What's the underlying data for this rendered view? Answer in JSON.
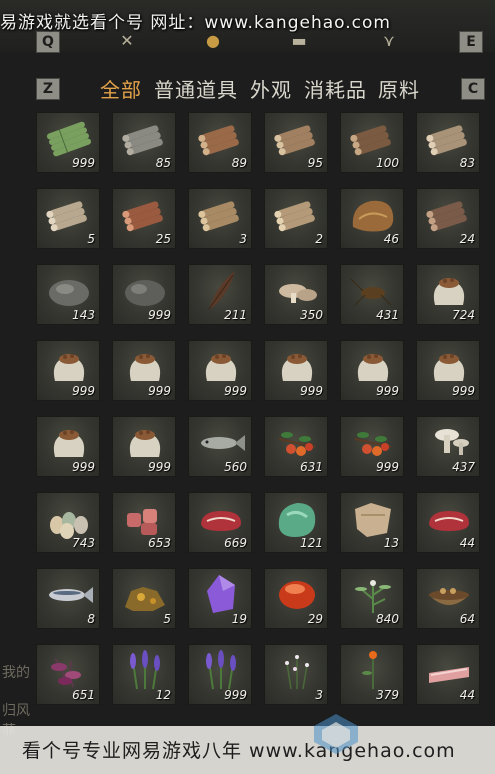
{
  "watermark_top": "易游戏就选看个号   网址：www.kangehao.com",
  "watermark_bottom": "看个号专业网易游戏八年  www.kangehao.com",
  "hotkeys": {
    "q": "Q",
    "e": "E",
    "z": "Z",
    "c": "C"
  },
  "tabs": [
    "全部",
    "普通道具",
    "外观",
    "消耗品",
    "原料"
  ],
  "left_deco": [
    "我的",
    "归风菲"
  ],
  "items": [
    {
      "icon": "bamboo-icon",
      "count": "999"
    },
    {
      "icon": "logs-grey-icon",
      "count": "85"
    },
    {
      "icon": "logs-brown-icon",
      "count": "89"
    },
    {
      "icon": "logs-icon",
      "count": "95"
    },
    {
      "icon": "firewood-icon",
      "count": "100"
    },
    {
      "icon": "logs-light-icon",
      "count": "83"
    },
    {
      "icon": "logs-pale-icon",
      "count": "5"
    },
    {
      "icon": "logs-red-icon",
      "count": "25"
    },
    {
      "icon": "logs-tan-icon",
      "count": "3"
    },
    {
      "icon": "logs-beige-icon",
      "count": "2"
    },
    {
      "icon": "fur-pelt-icon",
      "count": "46"
    },
    {
      "icon": "logs-dark-icon",
      "count": "24"
    },
    {
      "icon": "stone-icon",
      "count": "143"
    },
    {
      "icon": "stone-dark-icon",
      "count": "999"
    },
    {
      "icon": "feather-icon",
      "count": "211"
    },
    {
      "icon": "mushroom-icon",
      "count": "350"
    },
    {
      "icon": "cricket-icon",
      "count": "431"
    },
    {
      "icon": "seed-sack-icon",
      "count": "724"
    },
    {
      "icon": "seed-sack-icon",
      "count": "999"
    },
    {
      "icon": "seed-sack-icon",
      "count": "999"
    },
    {
      "icon": "seed-sack-icon",
      "count": "999"
    },
    {
      "icon": "seed-sack-icon",
      "count": "999"
    },
    {
      "icon": "seed-sack-icon",
      "count": "999"
    },
    {
      "icon": "seed-sack-icon",
      "count": "999"
    },
    {
      "icon": "seed-sack-icon",
      "count": "999"
    },
    {
      "icon": "seed-sack-icon",
      "count": "999"
    },
    {
      "icon": "fish-icon",
      "count": "560"
    },
    {
      "icon": "berry-branch-icon",
      "count": "631"
    },
    {
      "icon": "berry-branch-icon",
      "count": "999"
    },
    {
      "icon": "mushrooms-white-icon",
      "count": "437"
    },
    {
      "icon": "eggs-icon",
      "count": "743"
    },
    {
      "icon": "raw-meat-chunks-icon",
      "count": "653"
    },
    {
      "icon": "steak-icon",
      "count": "669"
    },
    {
      "icon": "jade-stone-icon",
      "count": "121"
    },
    {
      "icon": "hide-icon",
      "count": "13"
    },
    {
      "icon": "steak-icon",
      "count": "44"
    },
    {
      "icon": "salmon-icon",
      "count": "8"
    },
    {
      "icon": "ore-icon",
      "count": "5"
    },
    {
      "icon": "amethyst-icon",
      "count": "19"
    },
    {
      "icon": "red-gem-icon",
      "count": "29"
    },
    {
      "icon": "herb-icon",
      "count": "840"
    },
    {
      "icon": "herb-bowl-icon",
      "count": "64"
    },
    {
      "icon": "purple-flower-icon",
      "count": "651"
    },
    {
      "icon": "lavender-icon",
      "count": "12"
    },
    {
      "icon": "lavender-icon",
      "count": "999"
    },
    {
      "icon": "white-flower-icon",
      "count": "3"
    },
    {
      "icon": "orange-flower-icon",
      "count": "379"
    },
    {
      "icon": "meat-slices-icon",
      "count": "44"
    }
  ],
  "colors": {
    "active_tab": "#e3a34a",
    "tab": "#d9d6cc",
    "slot": "#353630"
  }
}
